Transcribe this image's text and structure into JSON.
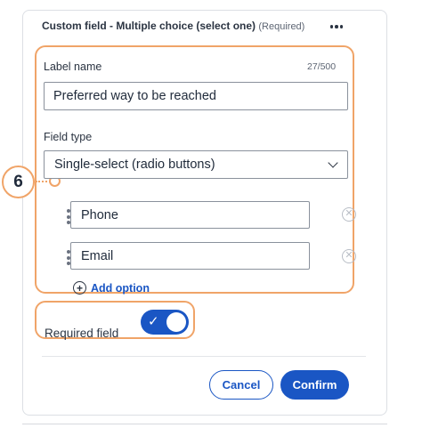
{
  "dialog": {
    "title": "Custom field - Multiple choice (select one)",
    "title_suffix": "(Required)"
  },
  "callout": {
    "number": "6"
  },
  "label_name": {
    "label": "Label name",
    "counter": "27/500",
    "value": "Preferred way to be reached"
  },
  "field_type": {
    "label": "Field type",
    "selected": "Single-select (radio buttons)"
  },
  "options": [
    {
      "value": "Phone"
    },
    {
      "value": "Email"
    }
  ],
  "add_option_label": "Add option",
  "required_field": {
    "label": "Required field",
    "enabled": true
  },
  "buttons": {
    "cancel": "Cancel",
    "confirm": "Confirm"
  },
  "icons": {
    "more": "more-horizontal-icon",
    "chevron": "chevron-down-icon",
    "drag": "drag-handle-icon",
    "remove": "remove-circle-icon",
    "add": "plus-circle-icon",
    "check": "check-icon"
  },
  "colors": {
    "accent": "#1a56c4",
    "highlight": "#f0a468",
    "text": "#1f2a3a"
  }
}
